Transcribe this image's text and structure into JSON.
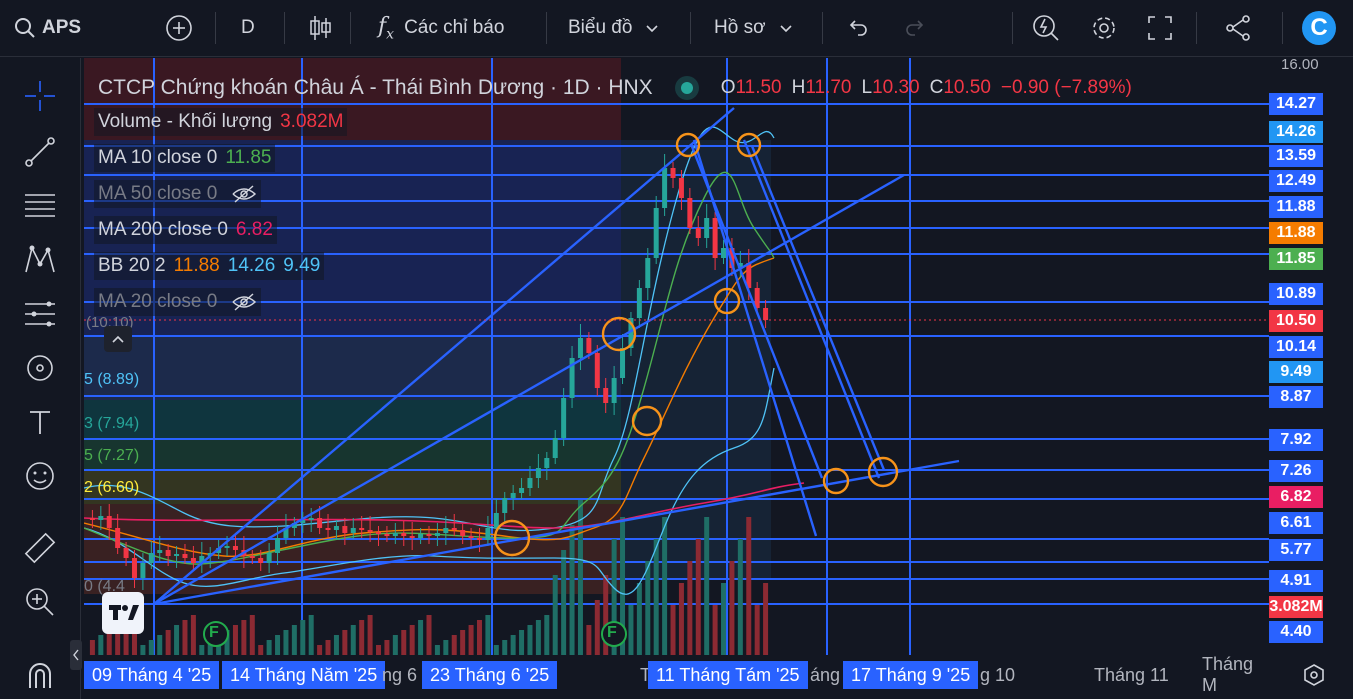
{
  "topbar": {
    "symbol": "APS",
    "interval": "D",
    "indicators_label": "Các chỉ báo",
    "chart_label": "Biểu đồ",
    "profile_label": "Hồ sơ",
    "logo_letter": "C"
  },
  "legend": {
    "title": "CTCP Chứng khoán Châu Á - Thái Bình Dương · 1D · HNX",
    "o_label": "O",
    "o_value": "11.50",
    "h_label": "H",
    "h_value": "11.70",
    "l_label": "L",
    "l_value": "10.30",
    "c_label": "C",
    "c_value": "10.50",
    "change": "−0.90 (−7.89%)",
    "volume_label": "Volume - Khối lượng",
    "volume_value": "3.082M",
    "ma10_label": "MA 10 close 0",
    "ma10_value": "11.85",
    "ma50_label": "MA 50 close 0",
    "ma200_label": "MA 200 close 0",
    "ma200_value": "6.82",
    "bb_label": "BB 20 2",
    "bb_v1": "11.88",
    "bb_v2": "14.26",
    "bb_v3": "9.49",
    "ma20_label": "MA 20 close 0"
  },
  "fib_labels": {
    "f1": "(10.10)",
    "f2": "5 (8.89)",
    "f3": "3 (7.94)",
    "f4": "5 (7.27)",
    "f5": "2 (6.60)",
    "f6": "0 (4.4"
  },
  "event_marker": "F",
  "price_axis": {
    "top": "16.00",
    "labels": [
      {
        "text": "14.27",
        "color": "#2962ff"
      },
      {
        "text": "14.26",
        "color": "#2196f3"
      },
      {
        "text": "13.59",
        "color": "#2962ff"
      },
      {
        "text": "12.49",
        "color": "#2962ff"
      },
      {
        "text": "11.88",
        "color": "#2962ff"
      },
      {
        "text": "11.88",
        "color": "#f57c00"
      },
      {
        "text": "11.85",
        "color": "#4caf50"
      },
      {
        "text": "10.89",
        "color": "#2962ff"
      },
      {
        "text": "10.50",
        "color": "#f23645"
      },
      {
        "text": "10.14",
        "color": "#2962ff"
      },
      {
        "text": "9.49",
        "color": "#2196f3"
      },
      {
        "text": "8.87",
        "color": "#2962ff"
      },
      {
        "text": "7.92",
        "color": "#2962ff"
      },
      {
        "text": "7.26",
        "color": "#2962ff"
      },
      {
        "text": "6.82",
        "color": "#e91e63"
      },
      {
        "text": "6.61",
        "color": "#2962ff"
      },
      {
        "text": "5.77",
        "color": "#2962ff"
      },
      {
        "text": "4.91",
        "color": "#2962ff"
      },
      {
        "text": "3.082M",
        "color": "#f23645"
      },
      {
        "text": "4.40",
        "color": "#2962ff"
      }
    ]
  },
  "time_axis": {
    "d1": "09 Tháng 4 '25",
    "d2": "14 Tháng Năm '25",
    "p1": "ng 6",
    "d3": "23 Tháng 6 '25",
    "p2": "T",
    "d4": "11 Tháng Tám '25",
    "p3": "áng",
    "d5": "17 Tháng 9 '25",
    "p4": "g 10",
    "p5": "Tháng 11",
    "p6": "Tháng M"
  }
}
